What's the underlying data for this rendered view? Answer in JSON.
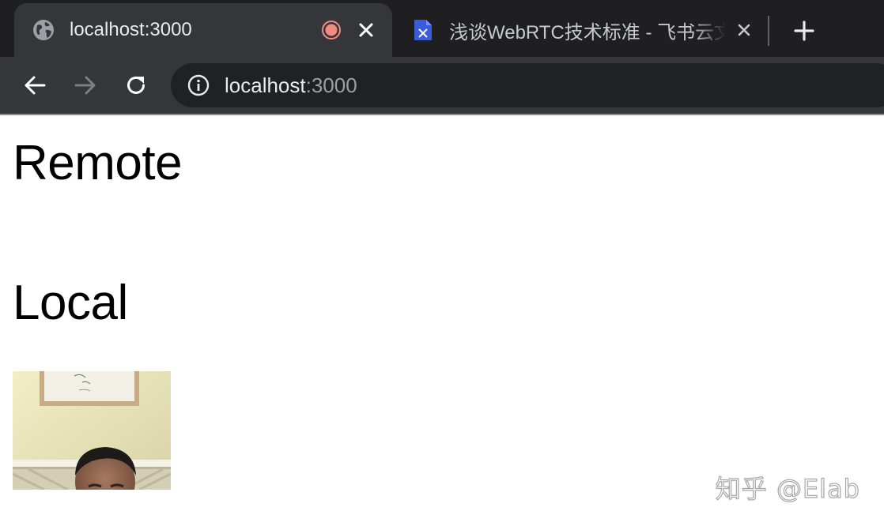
{
  "browser": {
    "tabs": [
      {
        "title": "localhost:3000",
        "active": true,
        "favicon": "globe-icon",
        "recording": true
      },
      {
        "title": "浅谈WebRTC技术标准 - 飞书云文档",
        "active": false,
        "favicon": "feishu-doc-icon"
      }
    ],
    "address_bar": {
      "host": "localhost",
      "port": ":3000"
    },
    "colors": {
      "tab_strip": "#1f1f21",
      "active_tab": "#35363a",
      "omnibox": "#202124",
      "recording_dot": "#f28b82",
      "doc_favicon": "#3b5bdb"
    }
  },
  "page": {
    "remote_heading": "Remote",
    "local_heading": "Local",
    "local_video": {
      "description_icon": "webcam-feed"
    }
  },
  "watermark": {
    "text": "知乎 @Elab"
  }
}
